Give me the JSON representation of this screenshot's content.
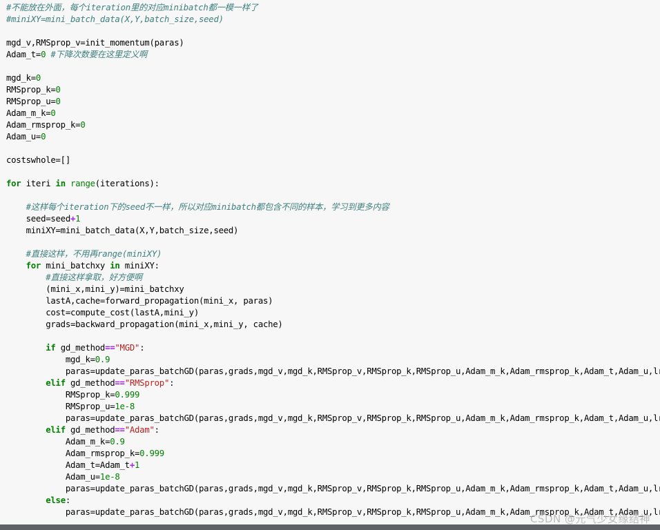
{
  "colors": {
    "background": "#f7f7f7",
    "comment": "#408080",
    "keyword": "#008000",
    "number": "#008000",
    "operator": "#aa22ff",
    "string": "#ba2121",
    "bottom_bar": "#5f6367"
  },
  "code_lines": [
    [
      [
        "cm",
        "#不能放在外面，每个iteration里的对应minibatch都一模一样了"
      ]
    ],
    [
      [
        "cm",
        "#miniXY=mini_batch_data(X,Y,batch_size,seed)"
      ]
    ],
    [],
    [
      [
        "tx",
        "mgd_v,RMSprop_v=init_momentum(paras)"
      ]
    ],
    [
      [
        "tx",
        "Adam_t="
      ],
      [
        "nm",
        "0"
      ],
      [
        "tx",
        " "
      ],
      [
        "cm",
        "#下降次数要在这里定义啊"
      ]
    ],
    [],
    [
      [
        "tx",
        "mgd_k="
      ],
      [
        "nm",
        "0"
      ]
    ],
    [
      [
        "tx",
        "RMSprop_k="
      ],
      [
        "nm",
        "0"
      ]
    ],
    [
      [
        "tx",
        "RMSprop_u="
      ],
      [
        "nm",
        "0"
      ]
    ],
    [
      [
        "tx",
        "Adam_m_k="
      ],
      [
        "nm",
        "0"
      ]
    ],
    [
      [
        "tx",
        "Adam_rmsprop_k="
      ],
      [
        "nm",
        "0"
      ]
    ],
    [
      [
        "tx",
        "Adam_u="
      ],
      [
        "nm",
        "0"
      ]
    ],
    [],
    [
      [
        "tx",
        "costswhole=[]"
      ]
    ],
    [],
    [
      [
        "kw",
        "for"
      ],
      [
        "tx",
        " iteri "
      ],
      [
        "kw",
        "in"
      ],
      [
        "tx",
        " "
      ],
      [
        "bi",
        "range"
      ],
      [
        "tx",
        "(iterations):"
      ]
    ],
    [],
    [
      [
        "tx",
        "    "
      ],
      [
        "cm",
        "#这样每个iteration下的seed不一样，所以对应minibatch都包含不同的样本，学习到更多内容"
      ]
    ],
    [
      [
        "tx",
        "    seed=seed"
      ],
      [
        "op",
        "+"
      ],
      [
        "nm",
        "1"
      ]
    ],
    [
      [
        "tx",
        "    miniXY=mini_batch_data(X,Y,batch_size,seed)"
      ]
    ],
    [],
    [
      [
        "tx",
        "    "
      ],
      [
        "cm",
        "#直接这样，不用再range(miniXY)"
      ]
    ],
    [
      [
        "tx",
        "    "
      ],
      [
        "kw",
        "for"
      ],
      [
        "tx",
        " mini_batchxy "
      ],
      [
        "kw",
        "in"
      ],
      [
        "tx",
        " miniXY:"
      ]
    ],
    [
      [
        "tx",
        "        "
      ],
      [
        "cm",
        "#直接这样拿取，好方便啊"
      ]
    ],
    [
      [
        "tx",
        "        (mini_x,mini_y)=mini_batchxy"
      ]
    ],
    [
      [
        "tx",
        "        lastA,cache=forward_propagation(mini_x, paras)"
      ]
    ],
    [
      [
        "tx",
        "        cost=compute_cost(lastA,mini_y)"
      ]
    ],
    [
      [
        "tx",
        "        grads=backward_propagation(mini_x,mini_y, cache)"
      ]
    ],
    [],
    [
      [
        "tx",
        "        "
      ],
      [
        "kw",
        "if"
      ],
      [
        "tx",
        " gd_method"
      ],
      [
        "op",
        "=="
      ],
      [
        "st",
        "\"MGD\""
      ],
      [
        "tx",
        ":"
      ]
    ],
    [
      [
        "tx",
        "            mgd_k="
      ],
      [
        "nm",
        "0.9"
      ]
    ],
    [
      [
        "tx",
        "            paras=update_paras_batchGD(paras,grads,mgd_v,mgd_k,RMSprop_v,RMSprop_k,RMSprop_u,Adam_m_k,Adam_rmsprop_k,Adam_t,Adam_u,lr)"
      ]
    ],
    [
      [
        "tx",
        "        "
      ],
      [
        "kw",
        "elif"
      ],
      [
        "tx",
        " gd_method"
      ],
      [
        "op",
        "=="
      ],
      [
        "st",
        "\"RMSprop\""
      ],
      [
        "tx",
        ":"
      ]
    ],
    [
      [
        "tx",
        "            RMSprop_k="
      ],
      [
        "nm",
        "0.999"
      ]
    ],
    [
      [
        "tx",
        "            RMSprop_u="
      ],
      [
        "nm",
        "1e-8"
      ]
    ],
    [
      [
        "tx",
        "            paras=update_paras_batchGD(paras,grads,mgd_v,mgd_k,RMSprop_v,RMSprop_k,RMSprop_u,Adam_m_k,Adam_rmsprop_k,Adam_t,Adam_u,lr)"
      ]
    ],
    [
      [
        "tx",
        "        "
      ],
      [
        "kw",
        "elif"
      ],
      [
        "tx",
        " gd_method"
      ],
      [
        "op",
        "=="
      ],
      [
        "st",
        "\"Adam\""
      ],
      [
        "tx",
        ":"
      ]
    ],
    [
      [
        "tx",
        "            Adam_m_k="
      ],
      [
        "nm",
        "0.9"
      ]
    ],
    [
      [
        "tx",
        "            Adam_rmsprop_k="
      ],
      [
        "nm",
        "0.999"
      ]
    ],
    [
      [
        "tx",
        "            Adam_t=Adam_t"
      ],
      [
        "op",
        "+"
      ],
      [
        "nm",
        "1"
      ]
    ],
    [
      [
        "tx",
        "            Adam_u="
      ],
      [
        "nm",
        "1e-8"
      ]
    ],
    [
      [
        "tx",
        "            paras=update_paras_batchGD(paras,grads,mgd_v,mgd_k,RMSprop_v,RMSprop_k,RMSprop_u,Adam_m_k,Adam_rmsprop_k,Adam_t,Adam_u,lr)"
      ]
    ],
    [
      [
        "tx",
        "        "
      ],
      [
        "kw",
        "else"
      ],
      [
        "tx",
        ":"
      ]
    ],
    [
      [
        "tx",
        "            paras=update_paras_batchGD(paras,grads,mgd_v,mgd_k,RMSprop_v,RMSprop_k,RMSprop_u,Adam_m_k,Adam_rmsprop_k,Adam_t,Adam_u,lr)"
      ]
    ]
  ],
  "watermark": "CSDN @元气少女缘结神"
}
